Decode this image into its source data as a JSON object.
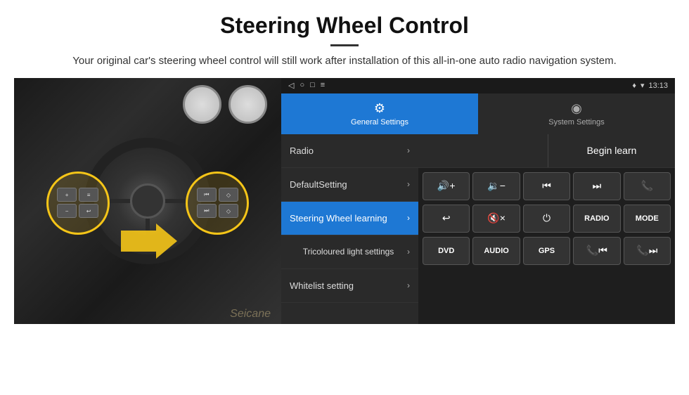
{
  "header": {
    "title": "Steering Wheel Control",
    "subtitle": "Your original car's steering wheel control will still work after installation of this all-in-one auto radio navigation system.",
    "divider": true
  },
  "status_bar": {
    "left_icons": [
      "◁",
      "○",
      "□",
      "≡"
    ],
    "right_text": "13:13",
    "right_icons": [
      "♦",
      "▾"
    ]
  },
  "tabs": [
    {
      "id": "general",
      "label": "General Settings",
      "icon": "⚙",
      "active": true
    },
    {
      "id": "system",
      "label": "System Settings",
      "icon": "◉",
      "active": false
    }
  ],
  "menu_items": [
    {
      "id": "radio",
      "label": "Radio",
      "active": false
    },
    {
      "id": "default",
      "label": "DefaultSetting",
      "active": false
    },
    {
      "id": "steering",
      "label": "Steering Wheel learning",
      "active": true
    },
    {
      "id": "tricoloured",
      "label": "Tricoloured light settings",
      "active": false
    },
    {
      "id": "whitelist",
      "label": "Whitelist setting",
      "active": false
    }
  ],
  "begin_learn_label": "Begin learn",
  "control_buttons_row1": [
    {
      "id": "vol-up",
      "symbol": "🔊+",
      "label": "vol-up"
    },
    {
      "id": "vol-down",
      "symbol": "🔉−",
      "label": "vol-down"
    },
    {
      "id": "prev-track",
      "symbol": "⏮",
      "label": "prev-track"
    },
    {
      "id": "next-track",
      "symbol": "⏭",
      "label": "next-track"
    },
    {
      "id": "phone",
      "symbol": "📞",
      "label": "phone"
    }
  ],
  "control_buttons_row2": [
    {
      "id": "hang-up",
      "symbol": "↩",
      "label": "hang-up"
    },
    {
      "id": "mute",
      "symbol": "🔇×",
      "label": "mute"
    },
    {
      "id": "power",
      "symbol": "⏻",
      "label": "power"
    },
    {
      "id": "radio-btn",
      "symbol": "RADIO",
      "label": "radio-btn",
      "text": true
    },
    {
      "id": "mode",
      "symbol": "MODE",
      "label": "mode",
      "text": true
    }
  ],
  "control_buttons_row3": [
    {
      "id": "dvd",
      "symbol": "DVD",
      "label": "dvd",
      "text": true
    },
    {
      "id": "audio",
      "symbol": "AUDIO",
      "label": "audio",
      "text": true
    },
    {
      "id": "gps",
      "symbol": "GPS",
      "label": "gps",
      "text": true
    },
    {
      "id": "tel-prev",
      "symbol": "📞⏮",
      "label": "tel-prev"
    },
    {
      "id": "tel-next",
      "symbol": "📞⏭",
      "label": "tel-next"
    }
  ],
  "watermark": "Seicane",
  "colors": {
    "accent_blue": "#1e78d4",
    "dark_bg": "#1a1a1a",
    "menu_bg": "#2a2a2a",
    "active_highlight": "#f5c518"
  }
}
